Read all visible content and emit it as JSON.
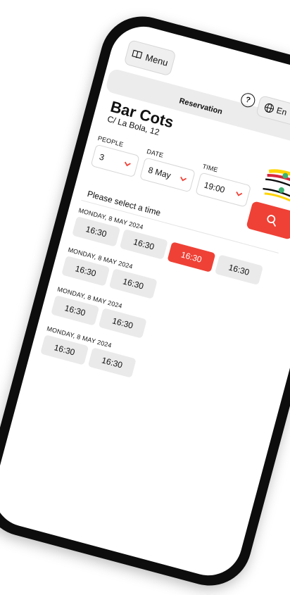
{
  "header": {
    "menu_label": "Menu",
    "nav_title": "Reservation",
    "help_glyph": "?",
    "language_label": "En"
  },
  "restaurant": {
    "name": "Bar Cots",
    "address": "C/ La Bola, 12"
  },
  "form": {
    "people_label": "PEOPLE",
    "people_value": "3",
    "date_label": "DATE",
    "date_value": "8 May",
    "time_label": "TIME",
    "time_value": "19:00"
  },
  "prompt": "Please select a time",
  "days": [
    {
      "label": "MONDAY, 8 MAY 2024",
      "slots": [
        "16:30",
        "16:30",
        "16:30",
        "16:30"
      ]
    },
    {
      "label": "MONDAY, 8 MAY 2024",
      "slots": [
        "16:30",
        "16:30"
      ]
    },
    {
      "label": "MONDAY, 8 MAY 2024",
      "slots": [
        "16:30",
        "16:30"
      ]
    },
    {
      "label": "MONDAY, 8 MAY 2024",
      "slots": [
        "16:30",
        "16:30"
      ]
    }
  ],
  "icons": {
    "menu": "book-icon",
    "help": "help-icon",
    "language": "globe-icon",
    "search": "search-icon",
    "dropdown": "chevron-down-icon"
  },
  "colors": {
    "accent": "#ef4136",
    "slot_bg": "#eaeaea",
    "frame": "#0d0d0d"
  }
}
